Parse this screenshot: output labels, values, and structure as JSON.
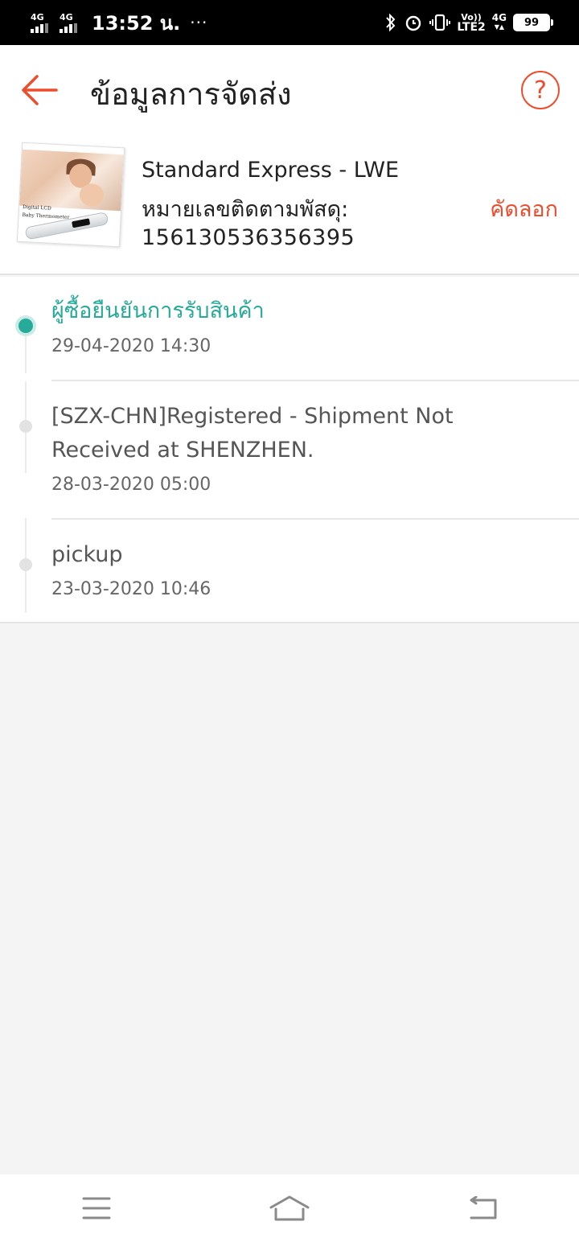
{
  "status_bar": {
    "net1": "4G",
    "net2": "4G",
    "time": "13:52 น.",
    "dots": "···",
    "volte": "Vo))",
    "lte": "LTE2",
    "net3": "4G",
    "battery": "99"
  },
  "header": {
    "title": "ข้อมูลการจัดส่ง",
    "help": "?"
  },
  "shipment": {
    "carrier": "Standard Express - LWE",
    "tracking_label": "หมายเลขติดตามพัสดุ:",
    "tracking_number": "156130536356395",
    "copy_label": "คัดลอก",
    "product_caption_1": "Digital LCD",
    "product_caption_2": "Baby Thermometer"
  },
  "timeline": [
    {
      "title": "ผู้ซื้อยืนยันการรับสินค้า",
      "time": "29-04-2020 14:30",
      "active": true
    },
    {
      "title": "[SZX-CHN]Registered - Shipment Not Received at SHENZHEN.",
      "time": "28-03-2020 05:00",
      "active": false
    },
    {
      "title": "pickup",
      "time": "23-03-2020 10:46",
      "active": false
    }
  ],
  "colors": {
    "accent": "#ee4d2d",
    "timeline_active": "#26aa99"
  },
  "icons": {
    "back": "arrow-left-icon",
    "help": "question-circle-icon",
    "menu": "menu-icon",
    "home": "home-icon",
    "return": "back-icon"
  }
}
